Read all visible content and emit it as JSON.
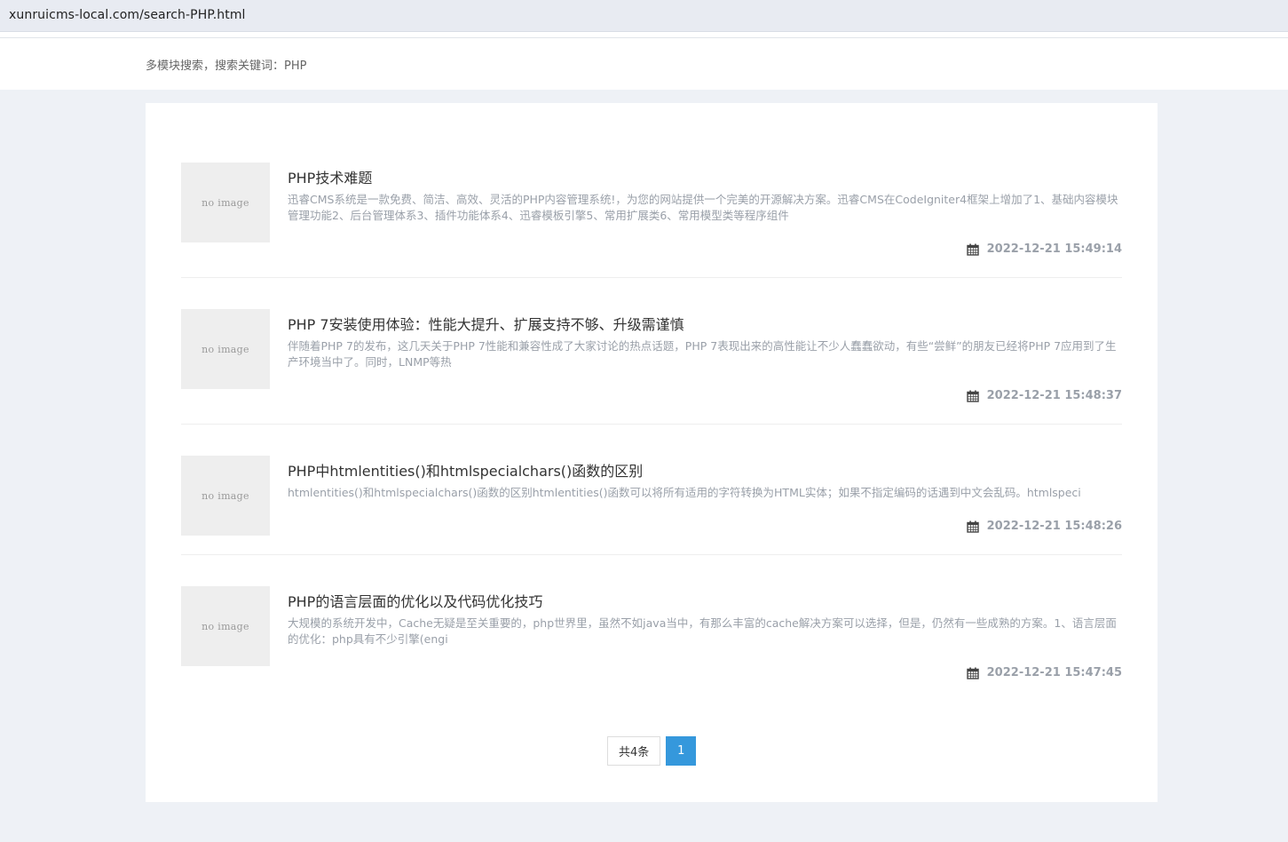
{
  "browser": {
    "url": "xunruicms-local.com/search-PHP.html"
  },
  "header": {
    "breadcrumb": "多模块搜索，搜索关键词：PHP"
  },
  "results": [
    {
      "thumb_text": "no image",
      "title": "PHP技术难题",
      "desc": "迅睿CMS系统是一款免费、简洁、高效、灵活的PHP内容管理系统!，为您的网站提供一个完美的开源解决方案。迅睿CMS在CodeIgniter4框架上增加了1、基础内容模块管理功能2、后台管理体系3、插件功能体系4、迅睿模板引擎5、常用扩展类6、常用模型类等程序组件",
      "date": "2022-12-21 15:49:14"
    },
    {
      "thumb_text": "no image",
      "title": "PHP 7安装使用体验：性能大提升、扩展支持不够、升级需谨慎",
      "desc": "伴随着PHP 7的发布，这几天关于PHP 7性能和兼容性成了大家讨论的热点话题，PHP 7表现出来的高性能让不少人蠢蠢欲动，有些“尝鲜”的朋友已经将PHP 7应用到了生产环境当中了。同时，LNMP等热",
      "date": "2022-12-21 15:48:37"
    },
    {
      "thumb_text": "no image",
      "title": "PHP中htmlentities()和htmlspecialchars()函数的区别",
      "desc": "htmlentities()和htmlspecialchars()函数的区别htmlentities()函数可以将所有适用的字符转换为HTML实体；如果不指定编码的话遇到中文会乱码。htmlspeci",
      "date": "2022-12-21 15:48:26"
    },
    {
      "thumb_text": "no image",
      "title": "PHP的语言层面的优化以及代码优化技巧",
      "desc": "大规模的系统开发中，Cache无疑是至关重要的，php世界里，虽然不如java当中，有那么丰富的cache解决方案可以选择，但是，仍然有一些成熟的方案。1、语言层面的优化：php具有不少引擎(engi",
      "date": "2022-12-21 15:47:45"
    }
  ],
  "pagination": {
    "total_label": "共4条",
    "current_page": "1"
  },
  "icons": {
    "calendar": "calendar-icon"
  },
  "colors": {
    "accent": "#3598dc",
    "muted_text": "#9aa0a9",
    "background": "#eef1f6"
  }
}
